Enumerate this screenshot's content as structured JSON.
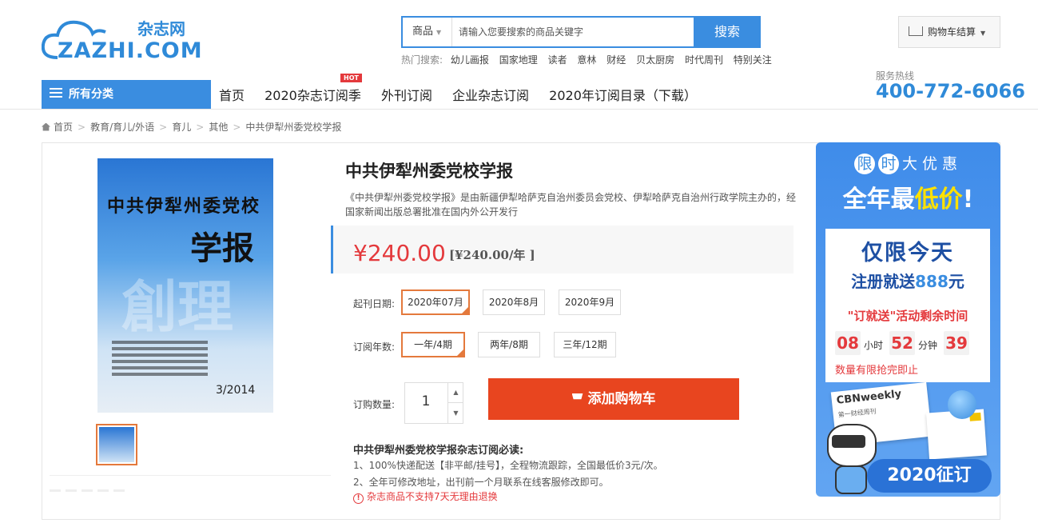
{
  "logo": {
    "cn": "杂志网",
    "en": "ZAZHI.COM"
  },
  "search": {
    "category": "商品",
    "placeholder": "请输入您要搜索的商品关键字",
    "button": "搜索"
  },
  "hot_search": {
    "label": "热门搜索:",
    "items": [
      "幼儿画报",
      "国家地理",
      "读者",
      "意林",
      "财经",
      "贝太厨房",
      "时代周刊",
      "特别关注"
    ]
  },
  "cart": {
    "label": "购物车结算"
  },
  "nav": {
    "all_categories": "所有分类",
    "items": [
      "首页",
      "2020杂志订阅季",
      "外刊订阅",
      "企业杂志订阅",
      "2020年订阅目录（下载）"
    ],
    "hot_badge": "HOT"
  },
  "hotline": {
    "label": "服务热线",
    "number": "400-772-6066"
  },
  "breadcrumb": [
    "首页",
    "教育/育儿/外语",
    "育儿",
    "其他",
    "中共伊犁州委党校学报"
  ],
  "cover": {
    "title_line1": "中共伊犁州委党校",
    "title_line2": "学报",
    "ghost": "創理",
    "issue": "3/2014"
  },
  "product": {
    "title": "中共伊犁州委党校学报",
    "description": "《中共伊犁州委党校学报》是由新疆伊犁哈萨克自治州委员会党校、伊犁哈萨克自治州行政学院主办的，经国家新闻出版总署批准在国内外公开发行",
    "price": "¥240.00",
    "price_per": "[¥240.00/年 ]",
    "start_label": "起刊日期:",
    "start_options": [
      "2020年07月",
      "2020年8月",
      "2020年9月"
    ],
    "start_selected": 0,
    "years_label": "订阅年数:",
    "years_options": [
      "一年/4期",
      "两年/8期",
      "三年/12期"
    ],
    "years_selected": 0,
    "qty_label": "订购数量:",
    "qty": "1",
    "add_cart": "添加购物车",
    "notice_title": "中共伊犁州委党校学报杂志订阅必读:",
    "notice1": "1、100%快递配送【非平邮/挂号】，全程物流跟踪，全国最低价3元/次。",
    "notice2": "2、全年可修改地址，出刊前一个月联系在线客服修改即可。",
    "warning": "杂志商品不支持7天无理由退换"
  },
  "promo": {
    "top_chars": [
      "限",
      "时",
      "大",
      "优",
      "惠"
    ],
    "big_pre": "全年最",
    "big_hl": "低价",
    "big_post": "!",
    "today": "仅限今天",
    "reg_pre": "注册就送",
    "reg_num": "888",
    "reg_post": "元",
    "activity": "\"订就送\"活动剩余时间",
    "hours": "08",
    "hours_unit": "小时",
    "minutes": "52",
    "minutes_unit": "分钟",
    "seconds": "39",
    "limited": "数量有限抢完即止",
    "mag_title": "CBNweekly",
    "mag_sub": "第一财经周刊",
    "badge": "2020征订"
  }
}
